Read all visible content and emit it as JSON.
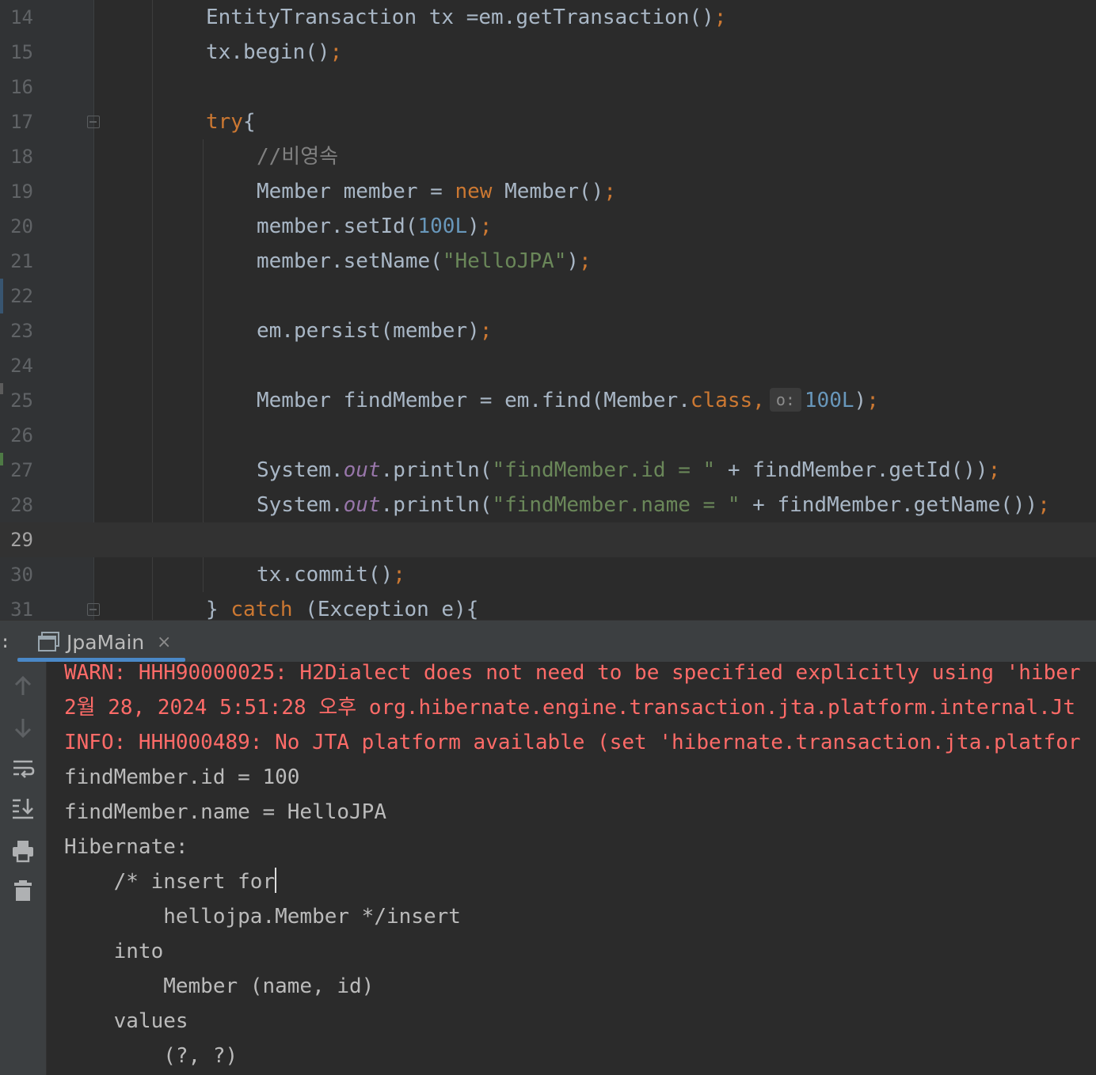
{
  "editor": {
    "current_line": "29",
    "lines": [
      {
        "num": "14",
        "code": [
          "EntityTransaction tx =em.getTransaction()",
          ";"
        ]
      },
      {
        "num": "15",
        "code": [
          "tx.begin()",
          ";"
        ]
      },
      {
        "num": "16"
      },
      {
        "num": "17",
        "code": [
          "try",
          "{"
        ]
      },
      {
        "num": "18",
        "code": [
          "//비영속"
        ]
      },
      {
        "num": "19",
        "code": [
          "Member member = ",
          "new",
          " Member()",
          ";"
        ]
      },
      {
        "num": "20",
        "code": [
          "member.setId(",
          "100L",
          ")",
          ";"
        ]
      },
      {
        "num": "21",
        "code": [
          "member.setName(",
          "\"HelloJPA\"",
          ")",
          ";"
        ]
      },
      {
        "num": "22"
      },
      {
        "num": "23",
        "code": [
          "em.persist(member)",
          ";"
        ]
      },
      {
        "num": "24"
      },
      {
        "num": "25",
        "code": [
          "Member findMember = em.find(Member.",
          "class",
          ",",
          "o:",
          "100L",
          ")",
          ";"
        ]
      },
      {
        "num": "26"
      },
      {
        "num": "27",
        "code": [
          "System.",
          "out",
          ".println(",
          "\"findMember.id = \"",
          " + findMember.getId())",
          ";"
        ]
      },
      {
        "num": "28",
        "code": [
          "System.",
          "out",
          ".println(",
          "\"findMember.name = \"",
          " + findMember.getName())",
          ";"
        ]
      },
      {
        "num": "29"
      },
      {
        "num": "30",
        "code": [
          "tx.commit()",
          ";"
        ]
      },
      {
        "num": "31",
        "code": [
          "} ",
          "catch",
          " (Exception e){"
        ]
      }
    ]
  },
  "run_panel": {
    "colon": ":",
    "tab_label": "JpaMain",
    "tab_close": "×",
    "side_tools": [
      "up-arrow-icon",
      "down-arrow-icon",
      "soft-wrap-icon",
      "scroll-to-end-icon",
      "print-icon",
      "trash-icon"
    ]
  },
  "console": {
    "lines": [
      {
        "text": "WARN: HHH90000025: H2Dialect does not need to be specified explicitly using 'hiber",
        "type": "err"
      },
      {
        "text": "2월 28, 2024 5:51:28 오후 org.hibernate.engine.transaction.jta.platform.internal.Jt",
        "type": "err"
      },
      {
        "text": "INFO: HHH000489: No JTA platform available (set 'hibernate.transaction.jta.platfor",
        "type": "err"
      },
      {
        "text": "findMember.id = 100",
        "type": "out"
      },
      {
        "text": "findMember.name = HelloJPA",
        "type": "out"
      },
      {
        "text": "Hibernate: ",
        "type": "out"
      },
      {
        "text": "    /* insert for",
        "type": "out"
      },
      {
        "text": "        hellojpa.Member */insert ",
        "type": "out"
      },
      {
        "text": "    into",
        "type": "out"
      },
      {
        "text": "        Member (name, id) ",
        "type": "out"
      },
      {
        "text": "    values",
        "type": "out"
      },
      {
        "text": "        (?, ?)",
        "type": "out"
      }
    ]
  },
  "colors": {
    "editor_bg": "#2b2b2b",
    "keyword": "#cc7832",
    "number": "#6897bb",
    "string": "#6a8759",
    "comment": "#808080",
    "static_field": "#9876aa",
    "error_text": "#ff6b68",
    "tab_underline": "#4a88c7"
  }
}
